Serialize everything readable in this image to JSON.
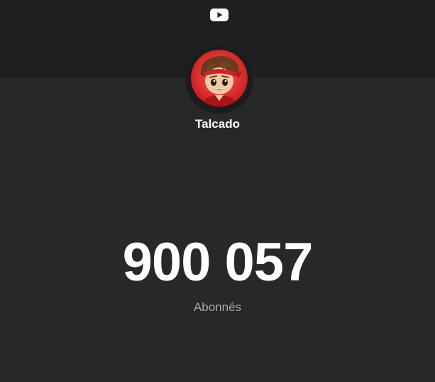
{
  "header": {
    "logo_icon": "youtube-play-icon",
    "band_color": "#1f1f1f"
  },
  "channel": {
    "name": "Talcado",
    "avatar_icon": "channel-avatar"
  },
  "stats": {
    "subscriber_count": "900 057",
    "subscriber_label": "Abonnés"
  },
  "colors": {
    "background": "#282828",
    "accent": "#ff0000",
    "primary_text": "#ffffff",
    "secondary_text": "#aaaaaa"
  }
}
